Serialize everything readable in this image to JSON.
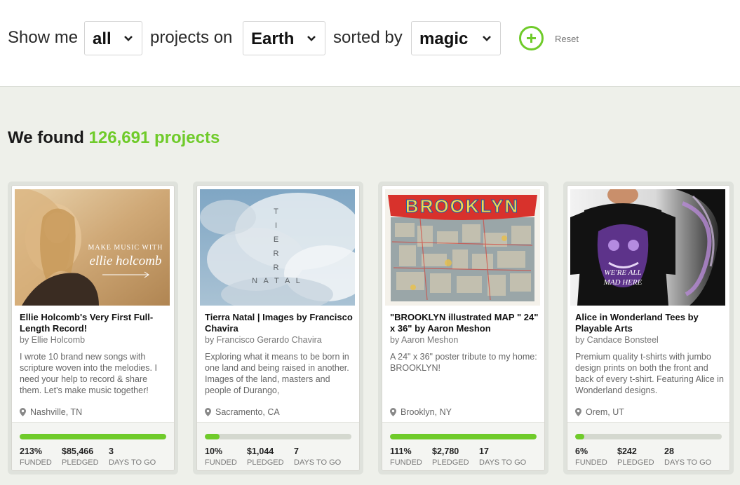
{
  "filters": {
    "show_me": "Show me",
    "category_value": "all",
    "projects_on": "projects on",
    "location_value": "Earth",
    "sorted_by": "sorted by",
    "sort_value": "magic",
    "reset_label": "Reset"
  },
  "results": {
    "prefix": "We found",
    "count": "126,691 projects"
  },
  "colors": {
    "accent": "#6fcb2a",
    "bar_track": "#d4d8cf",
    "background": "#eef0ea"
  },
  "projects": [
    {
      "title": "Ellie Holcomb's Very First Full-Length Record!",
      "byline": "by Ellie Holcomb",
      "blurb": "I wrote 10 brand new songs with scripture woven into the melodies. I need your help to record & share them. Let's make music together!",
      "location": "Nashville, TN",
      "funded_fraction": 1.0,
      "funded": "213%",
      "funded_label": "FUNDED",
      "pledged": "$85,466",
      "pledged_label": "PLEDGED",
      "days": "3",
      "days_label": "DAYS TO GO",
      "image_text_top": "MAKE MUSIC WITH",
      "image_text_script": "ellie holcomb"
    },
    {
      "title": "Tierra Natal | Images by Francisco Chavira",
      "byline": "by Francisco Gerardo Chavira",
      "blurb": "Exploring what it means to be born in one land and being raised in another. Images of the land, masters and people of Durango,",
      "location": "Sacramento, CA",
      "funded_fraction": 0.1,
      "funded": "10%",
      "funded_label": "FUNDED",
      "pledged": "$1,044",
      "pledged_label": "PLEDGED",
      "days": "7",
      "days_label": "DAYS TO GO",
      "image_text": [
        "T",
        "I",
        "E",
        "R",
        "R",
        "A",
        "N A T A L"
      ]
    },
    {
      "title": "\"BROOKLYN illustrated MAP \" 24\" x 36\" by Aaron Meshon",
      "byline": "by Aaron Meshon",
      "blurb": "A 24\" x 36\" poster tribute to my home: BROOKLYN!",
      "location": "Brooklyn, NY",
      "funded_fraction": 1.0,
      "funded": "111%",
      "funded_label": "FUNDED",
      "pledged": "$2,780",
      "pledged_label": "PLEDGED",
      "days": "17",
      "days_label": "DAYS TO GO",
      "image_text": "BROOKLYN"
    },
    {
      "title": "Alice in Wonderland Tees by Playable Arts",
      "byline": "by Candace Bonsteel",
      "blurb": "Premium quality t-shirts with jumbo design prints on both the front and back of every t-shirt. Featuring Alice in Wonderland designs.",
      "location": "Orem, UT",
      "funded_fraction": 0.06,
      "funded": "6%",
      "funded_label": "FUNDED",
      "pledged": "$242",
      "pledged_label": "PLEDGED",
      "days": "28",
      "days_label": "DAYS TO GO",
      "image_text": [
        "WE'RE ALL",
        "MAD HERE"
      ]
    }
  ]
}
